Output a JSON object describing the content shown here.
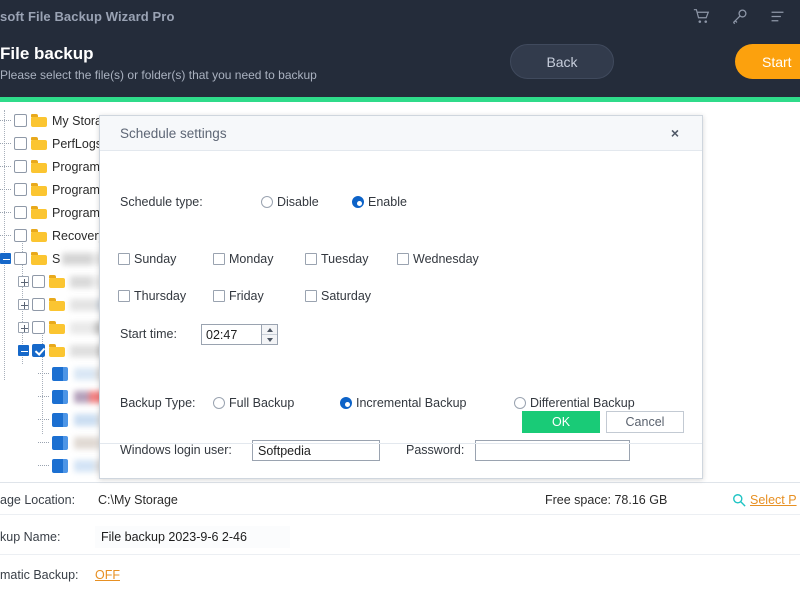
{
  "titlebar": {
    "app_title": "soft File Backup Wizard Pro",
    "icons": [
      {
        "name": "cart-icon",
        "label": "Shopping cart"
      },
      {
        "name": "key-icon",
        "label": "License key"
      },
      {
        "name": "menu-icon",
        "label": "Menu"
      }
    ]
  },
  "header": {
    "title": "File backup",
    "subtitle": "Please select the file(s) or folder(s) that you need to backup",
    "back_label": "Back",
    "start_label": "Start",
    "accent_color": "#2fdb8a",
    "start_color": "#fca10d"
  },
  "tree": {
    "items": [
      {
        "label": "My Storage",
        "type": "folder",
        "checked": false,
        "indent": 0,
        "censored": false
      },
      {
        "label": "PerfLogs",
        "type": "folder",
        "checked": false,
        "indent": 0,
        "censored": false
      },
      {
        "label": "Program F",
        "type": "folder",
        "checked": false,
        "indent": 0,
        "censored": false
      },
      {
        "label": "Program F",
        "type": "folder",
        "checked": false,
        "indent": 0,
        "censored": false
      },
      {
        "label": "ProgramDa",
        "type": "folder",
        "checked": false,
        "indent": 0,
        "censored": false
      },
      {
        "label": "Recovery",
        "type": "folder",
        "checked": false,
        "indent": 0,
        "censored": false
      },
      {
        "label": "S",
        "type": "folder",
        "checked": false,
        "indent": 0,
        "censored": true,
        "expanded": true
      },
      {
        "label": "",
        "type": "folder",
        "checked": false,
        "indent": 1,
        "censored": true,
        "expandable": true
      },
      {
        "label": "",
        "type": "folder",
        "checked": false,
        "indent": 1,
        "censored": true,
        "expandable": true
      },
      {
        "label": "",
        "type": "folder",
        "checked": false,
        "indent": 1,
        "censored": true,
        "expandable": true
      },
      {
        "label": "",
        "type": "folder",
        "checked": true,
        "indent": 1,
        "censored": true,
        "expanded": true
      },
      {
        "label": "",
        "type": "file",
        "checked": true,
        "indent": 2,
        "censored": true
      },
      {
        "label": "",
        "type": "file",
        "checked": true,
        "indent": 2,
        "censored": true
      },
      {
        "label": "",
        "type": "file",
        "checked": true,
        "indent": 2,
        "censored": true
      },
      {
        "label": "",
        "type": "file",
        "checked": true,
        "indent": 2,
        "censored": true
      },
      {
        "label": "",
        "type": "file",
        "checked": true,
        "indent": 2,
        "censored": true
      }
    ]
  },
  "dialog": {
    "title": "Schedule settings",
    "close_label": "×",
    "schedule_type_label": "Schedule type:",
    "schedule_type_options": [
      {
        "label": "Disable",
        "selected": false
      },
      {
        "label": "Enable",
        "selected": true
      }
    ],
    "days": [
      {
        "label": "Sunday",
        "checked": false
      },
      {
        "label": "Monday",
        "checked": false
      },
      {
        "label": "Tuesday",
        "checked": false
      },
      {
        "label": "Wednesday",
        "checked": false
      },
      {
        "label": "Thursday",
        "checked": false
      },
      {
        "label": "Friday",
        "checked": false
      },
      {
        "label": "Saturday",
        "checked": false
      }
    ],
    "start_time_label": "Start time:",
    "start_time_value": "02:47",
    "backup_type_label": "Backup Type:",
    "backup_type_options": [
      {
        "label": "Full Backup",
        "selected": false
      },
      {
        "label": "Incremental Backup",
        "selected": true
      },
      {
        "label": "Differential Backup",
        "selected": false
      }
    ],
    "login_user_label": "Windows login user:",
    "login_user_value": "Softpedia",
    "password_label": "Password:",
    "password_value": "",
    "ok_label": "OK",
    "cancel_label": "Cancel",
    "ok_color": "#19cb77"
  },
  "bottom": {
    "storage_location_label": "age Location:",
    "storage_location_value": "C:\\My Storage",
    "free_space_text": "Free space: 78.16 GB",
    "select_path_label": "Select P",
    "backup_name_label": "kup Name:",
    "backup_name_value": "File backup 2023-9-6 2-46",
    "automatic_backup_label": "matic Backup:",
    "automatic_backup_value": "OFF",
    "link_color": "#e79023"
  }
}
